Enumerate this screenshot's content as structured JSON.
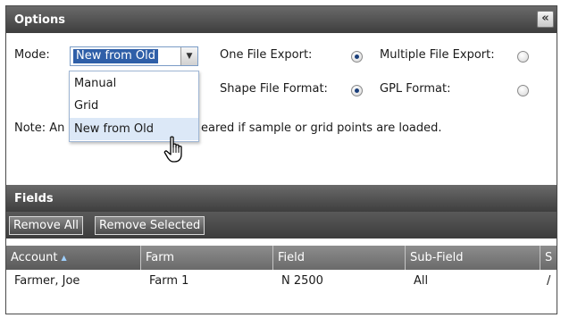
{
  "options": {
    "title": "Options",
    "collapse_glyph": "«",
    "mode_label": "Mode:",
    "mode_value": "New from Old",
    "mode_options": [
      "Manual",
      "Grid",
      "New from Old"
    ],
    "one_file_export_label": "One File Export:",
    "multiple_file_export_label": "Multiple File Export:",
    "shape_file_format_label": "Shape File Format:",
    "gpl_format_label": "GPL Format:",
    "note_start": "Note: An",
    "note_end": "eared if sample or grid points are loaded.",
    "export_selected": "one_file",
    "format_selected": "shape_file"
  },
  "fields": {
    "title": "Fields",
    "remove_all_label": "Remove All",
    "remove_selected_label": "Remove Selected",
    "columns": [
      "Account",
      "Farm",
      "Field",
      "Sub-Field",
      "S"
    ],
    "sorted_column": "Account",
    "rows": [
      [
        "Farmer, Joe",
        "Farm 1",
        "N 2500",
        "All",
        "/"
      ]
    ]
  },
  "icons": {
    "collapse": "double-chevron-left-icon",
    "dropdown_arrow": "chevron-down-icon",
    "sort": "sort-ascending-icon",
    "cursor": "hand-pointer-cursor-icon"
  },
  "colors": {
    "header_bg": "#4a4a4a",
    "selection_bg": "#2f5fa8",
    "hover_bg": "#dce8f7"
  }
}
